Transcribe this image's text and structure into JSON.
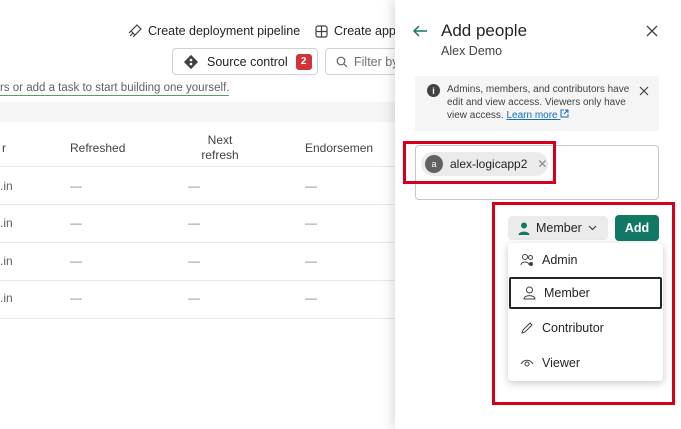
{
  "toolbar": {
    "deploy_label": "Create deployment pipeline",
    "create_app_label": "Create app",
    "source_control_label": "Source control",
    "source_control_count": "2",
    "filter_placeholder": "Filter by"
  },
  "workspace": {
    "hint_text": "rs or add a task to start building one yourself.",
    "columns": [
      "r",
      "Refreshed",
      "Next refresh",
      "Endorsemen"
    ],
    "rows": [
      {
        "owner": ".in",
        "refreshed": "—",
        "next": "—",
        "endorse": "—"
      },
      {
        "owner": ".in",
        "refreshed": "—",
        "next": "—",
        "endorse": "—"
      },
      {
        "owner": ".in",
        "refreshed": "—",
        "next": "—",
        "endorse": "—"
      },
      {
        "owner": ".in",
        "refreshed": "—",
        "next": "—",
        "endorse": "—"
      }
    ]
  },
  "panel": {
    "title": "Add people",
    "subtitle": "Alex Demo",
    "info_text": "Admins, members, and contributors have edit and view access. Viewers only have view access.",
    "info_link": "Learn more",
    "chip_initial": "a",
    "chip_label": "alex-logicapp2",
    "role_selected": "Member",
    "add_label": "Add",
    "roles": [
      {
        "label": "Admin",
        "icon": "admin-icon"
      },
      {
        "label": "Member",
        "icon": "member-icon"
      },
      {
        "label": "Contributor",
        "icon": "pencil-icon"
      },
      {
        "label": "Viewer",
        "icon": "eye-icon"
      }
    ]
  },
  "colors": {
    "accent": "#117865",
    "highlight": "#d4001b",
    "badge": "#d13438"
  }
}
